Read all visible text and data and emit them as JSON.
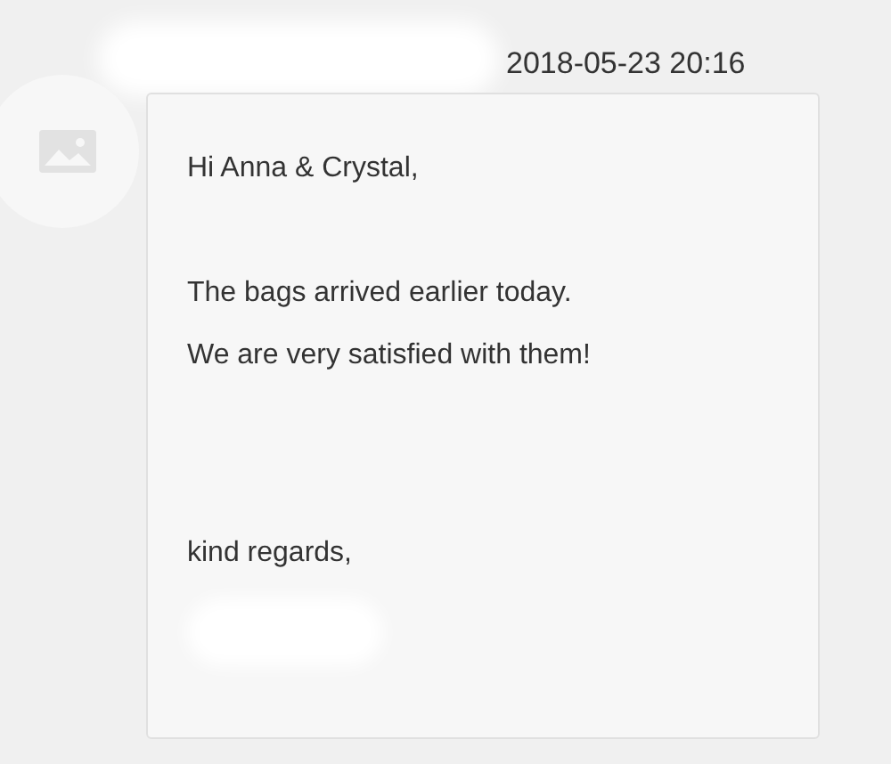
{
  "message": {
    "timestamp": "2018-05-23 20:16",
    "greeting": "Hi Anna & Crystal,",
    "body": [
      "The bags arrived earlier today.",
      "We are very satisfied with them!"
    ],
    "closing": "kind regards,"
  }
}
